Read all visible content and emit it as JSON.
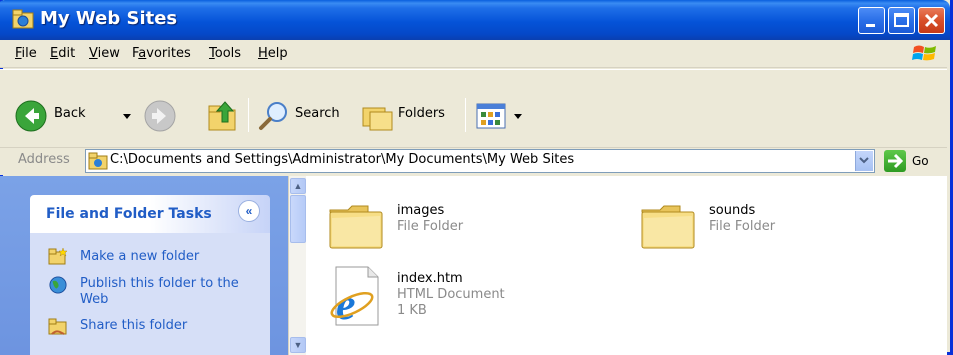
{
  "window": {
    "title": "My Web Sites",
    "title_color": "#0553d8"
  },
  "menu": {
    "items": [
      "File",
      "Edit",
      "View",
      "Favorites",
      "Tools",
      "Help"
    ],
    "underline": [
      "F",
      "E",
      "V",
      "a",
      "T",
      "H"
    ]
  },
  "toolbar": {
    "back_label": "Back",
    "search_label": "Search",
    "folders_label": "Folders"
  },
  "address": {
    "label": "Address",
    "path": "C:\\Documents and Settings\\Administrator\\My Documents\\My Web Sites",
    "go_label": "Go"
  },
  "tasks": {
    "title": "File and Folder Tasks",
    "links": [
      "Make a new folder",
      "Publish this folder to the Web",
      "Share this folder"
    ]
  },
  "files": [
    {
      "name": "images",
      "type": "File Folder",
      "icon": "folder-icon"
    },
    {
      "name": "sounds",
      "type": "File Folder",
      "icon": "folder-icon"
    },
    {
      "name": "index.htm",
      "type": "HTML Document",
      "size": "1 KB",
      "icon": "html-document-icon"
    }
  ],
  "colors": {
    "task_link": "#215dc6",
    "task_pane": "#7ba2e7",
    "subtext": "#8a8a8a"
  }
}
